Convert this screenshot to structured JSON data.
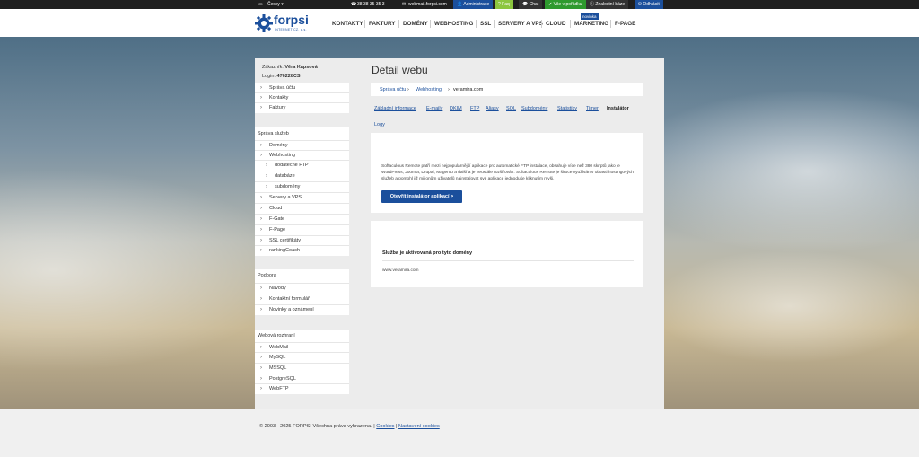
{
  "topbar": {
    "language": "Česky",
    "phone": "38 38 35 35 3",
    "email": "webmail.forpsi.com",
    "admin": "Administrace",
    "faq": "Faq",
    "chat": "Chat",
    "status": "Vše v pořádku",
    "kb": "Znalostní báze",
    "logout": "Odhlásit"
  },
  "logo": {
    "name": "forpsi",
    "sub": "INTERNET CZ, a.s."
  },
  "nav": {
    "items": [
      "KONTAKTY",
      "FAKTURY",
      "DOMÉNY",
      "WEBHOSTING",
      "SSL",
      "SERVERY A VPS",
      "CLOUD",
      "MARKETING",
      "F-PAGE"
    ],
    "badge": "novinka"
  },
  "customer": {
    "name_label": "Zákazník:",
    "name": "Věra Kapsová",
    "login_label": "Login:",
    "login": "476228CS"
  },
  "sidebar": {
    "account": [
      "Správa účtu",
      "Kontakty",
      "Faktury"
    ],
    "services_title": "Správa služeb",
    "services": [
      {
        "label": "Domény",
        "sub": false
      },
      {
        "label": "Webhosting",
        "sub": false
      },
      {
        "label": "dodatečné FTP",
        "sub": true
      },
      {
        "label": "databáze",
        "sub": true
      },
      {
        "label": "subdomény",
        "sub": true
      },
      {
        "label": "Servery a VPS",
        "sub": false
      },
      {
        "label": "Cloud",
        "sub": false
      },
      {
        "label": "F-Gate",
        "sub": false
      },
      {
        "label": "F-Page",
        "sub": false
      },
      {
        "label": "SSL certifikáty",
        "sub": false
      },
      {
        "label": "rankingCoach",
        "sub": false
      }
    ],
    "support_title": "Podpora",
    "support": [
      "Návody",
      "Kontaktní formulář",
      "Novinky a oznámení"
    ],
    "web_title": "Webová rozhraní",
    "web": [
      "WebMail",
      "MySQL",
      "MSSQL",
      "PostgreSQL",
      "WebFTP"
    ]
  },
  "content": {
    "title": "Detail webu",
    "breadcrumb": [
      "Správa účtu",
      "Webhosting",
      "veramira.com"
    ],
    "tabs": [
      "Základní informace",
      "E-maily",
      "DKIM",
      "FTP",
      "Aliasy",
      "SQL",
      "Subdomény",
      "Statistiky",
      "Timer",
      "Instalátor",
      "Logy"
    ],
    "active_tab": "Instalátor",
    "description": "Softaculous Remote patří mezi nejpopulárnější aplikace pro automatické FTP instalace, obsahuje více než 380 skriptů jako je WordPress, Joomla, Drupal, Magento a další a je neustále rozšiřován. Softaculous Remote je široce využíván v oblasti hostingových služeb a pomohl již milionům uživatelů nainstalovat své aplikace jednoduše kliknutím myši.",
    "button": "Otevřít instalátor aplikací >",
    "service_title": "Služba je aktivovaná pro tyto domény",
    "service_domain": "www.veramira.com"
  },
  "footer": {
    "copyright": "© 2003 - 2025 FORPSI Všechna práva vyhrazena.",
    "cookies": "Cookies",
    "cookie_settings": "Nastavení cookies"
  },
  "colors": {
    "brand": "#1b4f9c",
    "topbar": "#1f1f1f",
    "status_green": "#2e9a2e",
    "faq_green": "#8cc63f"
  }
}
